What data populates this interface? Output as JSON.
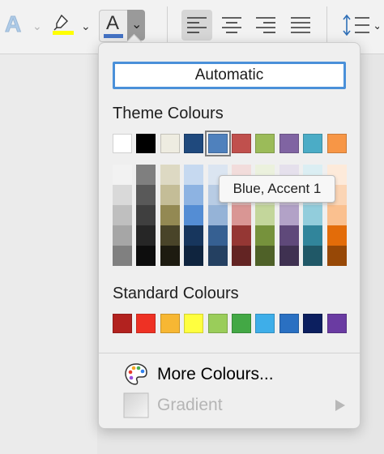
{
  "toolbar": {
    "text_effects_glyph": "A",
    "font_color_glyph": "A",
    "font_color_underline": "#4472C4",
    "highlight_color": "#FFFF00",
    "caret_glyph": "⌄",
    "dropdown_glyph": "⌄",
    "alignment_buttons": [
      "align-left",
      "align-center",
      "align-right",
      "justify"
    ],
    "active_alignment": "align-left"
  },
  "popover": {
    "automatic_label": "Automatic",
    "theme_colours_label": "Theme Colours",
    "standard_colours_label": "Standard Colours",
    "theme_colours": [
      "#FFFFFF",
      "#000000",
      "#EEECE1",
      "#1F497D",
      "#4F81BD",
      "#C0504D",
      "#9BBB59",
      "#8064A2",
      "#4BACC6",
      "#F79646"
    ],
    "selected_theme_index": 4,
    "theme_tints": [
      [
        "#F2F2F2",
        "#D9D9D9",
        "#BFBFBF",
        "#A6A6A6",
        "#808080"
      ],
      [
        "#7F7F7F",
        "#595959",
        "#3F3F3F",
        "#262626",
        "#0D0D0D"
      ],
      [
        "#DDD9C3",
        "#C4BD97",
        "#938953",
        "#494429",
        "#1D1B10"
      ],
      [
        "#C6D9F0",
        "#8DB3E2",
        "#548DD4",
        "#17365D",
        "#0F243E"
      ],
      [
        "#DBE5F1",
        "#B8CCE4",
        "#95B3D7",
        "#366092",
        "#244061"
      ],
      [
        "#F2DCDB",
        "#E5B9B7",
        "#D99694",
        "#953734",
        "#632423"
      ],
      [
        "#EBF1DD",
        "#D7E3BC",
        "#C3D69B",
        "#76923C",
        "#4F6128"
      ],
      [
        "#E5E0EC",
        "#CCC1D9",
        "#B2A2C7",
        "#5F497A",
        "#3F3151"
      ],
      [
        "#DBEEF3",
        "#B7DDE8",
        "#92CDDC",
        "#31859B",
        "#205867"
      ],
      [
        "#FDEADA",
        "#FBD5B5",
        "#FAC08F",
        "#E36C09",
        "#974806"
      ]
    ],
    "standard_colours": [
      "#B2221F",
      "#EE3124",
      "#F7B733",
      "#FFFF3F",
      "#9ACD5A",
      "#43A845",
      "#3EAEE9",
      "#2A70C2",
      "#0C1F5F",
      "#6A3BA2"
    ],
    "tooltip_text": "Blue, Accent 1",
    "more_colours_label": "More Colours...",
    "gradient_label": "Gradient"
  }
}
